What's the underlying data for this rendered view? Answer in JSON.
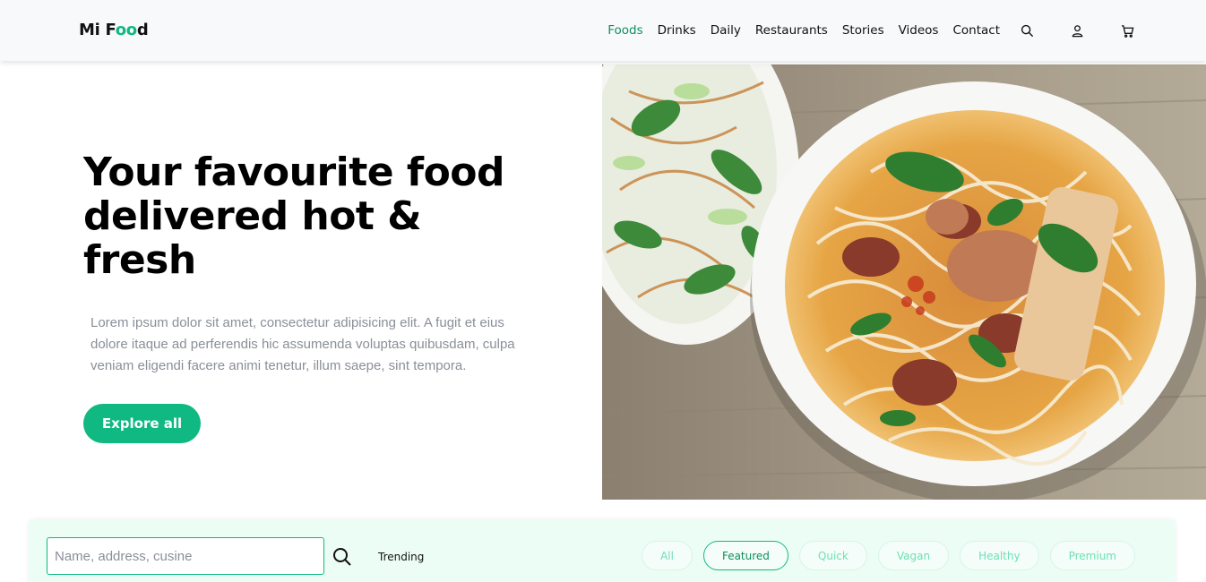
{
  "logo": {
    "prefix": "Mi F",
    "highlight": "oo",
    "suffix": "d"
  },
  "nav": {
    "items": [
      {
        "label": "Foods",
        "active": true
      },
      {
        "label": "Drinks",
        "active": false
      },
      {
        "label": "Daily",
        "active": false
      },
      {
        "label": "Restaurants",
        "active": false
      },
      {
        "label": "Stories",
        "active": false
      },
      {
        "label": "Videos",
        "active": false
      },
      {
        "label": "Contact",
        "active": false
      }
    ],
    "icons": [
      "search-icon",
      "user-icon",
      "cart-icon"
    ]
  },
  "hero": {
    "title_line1": "Your favourite food",
    "title_line2": "delivered hot &",
    "title_line3": "fresh",
    "text": "Lorem ipsum dolor sit amet, consectetur adipisicing elit. A fugit et eius dolore itaque ad perferendis hic assumenda voluptas quibusdam, culpa veniam eligendi facere animi tenetur, illum saepe, sint tempora.",
    "button_label": "Explore all"
  },
  "search": {
    "placeholder": "Name, address, cusine",
    "value": "",
    "trending_label": "Trending",
    "filters": [
      {
        "label": "All",
        "active": false
      },
      {
        "label": "Featured",
        "active": true
      },
      {
        "label": "Quick",
        "active": false
      },
      {
        "label": "Vagan",
        "active": false
      },
      {
        "label": "Healthy",
        "active": false
      },
      {
        "label": "Premium",
        "active": false
      }
    ]
  },
  "colors": {
    "accent": "#10b981",
    "accent_dark": "#0f8f5c",
    "search_bg": "#ecfdf5",
    "header_bg": "#f8f9fa",
    "muted_text": "#8a8f98"
  }
}
